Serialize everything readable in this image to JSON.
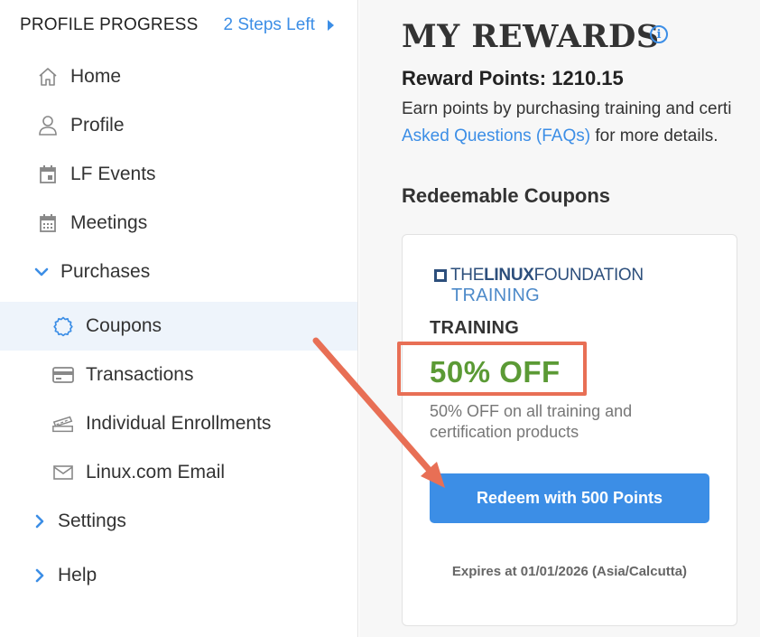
{
  "sidebar": {
    "profile_progress": {
      "title": "PROFILE PROGRESS",
      "steps": "2 Steps Left"
    },
    "items": [
      {
        "label": "Home",
        "icon": "home-icon"
      },
      {
        "label": "Profile",
        "icon": "user-icon"
      },
      {
        "label": "LF Events",
        "icon": "calendar-icon"
      },
      {
        "label": "Meetings",
        "icon": "calendar-grid-icon"
      },
      {
        "label": "Purchases",
        "icon": "chevron-down-icon"
      },
      {
        "label": "Coupons",
        "icon": "coupon-icon",
        "active": true
      },
      {
        "label": "Transactions",
        "icon": "credit-card-icon"
      },
      {
        "label": "Individual Enrollments",
        "icon": "ticket-icon"
      },
      {
        "label": "Linux.com Email",
        "icon": "mail-icon"
      },
      {
        "label": "Settings",
        "icon": "chevron-right-icon"
      },
      {
        "label": "Help",
        "icon": "chevron-right-icon"
      }
    ]
  },
  "main": {
    "title": "MY REWARDS",
    "reward_points": "Reward Points: 1210.15",
    "earn_text_1": "Earn points by purchasing training and certi",
    "earn_link": "Asked Questions (FAQs)",
    "earn_text_2": " for more details.",
    "section_title": "Redeemable Coupons",
    "coupon": {
      "logo_line1_a": "THE ",
      "logo_line1_b": "LINUX",
      "logo_line1_c": " FOUNDATION",
      "logo_line2": "TRAINING",
      "category": "TRAINING",
      "discount": "50% OFF",
      "description": "50% OFF on all training and certification products",
      "button": "Redeem with 500 Points",
      "expires": "Expires at 01/01/2026 (Asia/Calcutta)"
    }
  },
  "colors": {
    "accent": "#3c8ee6",
    "discount": "#5b9a35",
    "annotation": "#e86f55"
  }
}
